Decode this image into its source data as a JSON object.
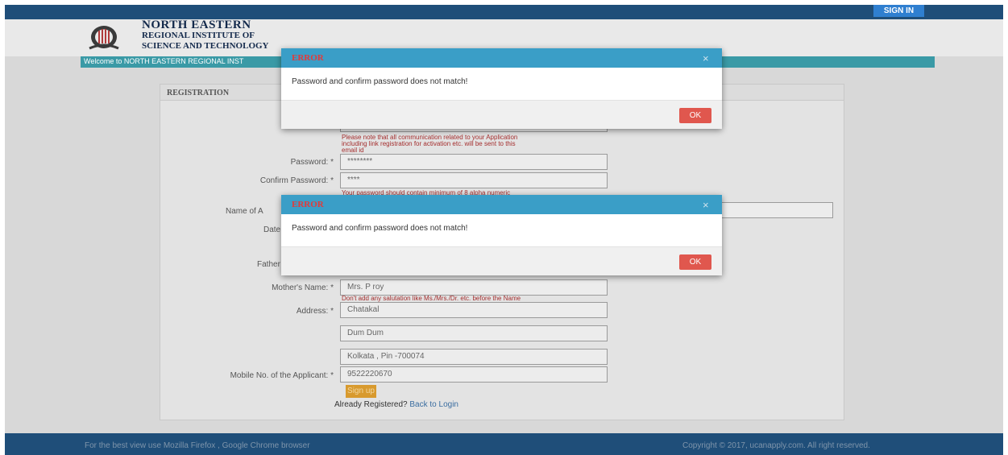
{
  "topbar": {
    "signin_label": "SIGN IN"
  },
  "header": {
    "institute_line1": "NORTH EASTERN",
    "institute_line2": "REGIONAL INSTITUTE OF",
    "institute_line3": "SCIENCE AND TECHNOLOGY",
    "welcome_text": "Welcome to NORTH EASTERN REGIONAL INST"
  },
  "registration": {
    "title": "REGISTRATION",
    "email_hint": "Please note that all communication related to your Application including link registration for activation etc. will be sent to this email id",
    "email_hint_lines": [
      "Please note that all communication related to your Application",
      "including link registration for activation etc. will be sent to this",
      "email id"
    ],
    "password_label": "Password: *",
    "password_value": "********",
    "confirm_password_label": "Confirm Password: *",
    "confirm_password_value": "****",
    "password_hint": "Your password should contain minimum of 8 alpha numeric",
    "name_label": "Name of A",
    "date_label": "Date",
    "father_label": "Father",
    "mother_label": "Mother's Name: *",
    "mother_value": "Mrs. P roy",
    "mother_hint": "Don't add any salutation like Ms./Mrs./Dr. etc. before the Name",
    "address_label": "Address: *",
    "address_line1": "Chatakal",
    "address_line2": "Dum Dum",
    "address_line3": "Kolkata , Pin -700074",
    "mobile_label": "Mobile No. of the Applicant: *",
    "mobile_value": "9522220670",
    "signup_label": "Sign up",
    "already_registered": "Already Registered?",
    "back_to_login": "Back to Login"
  },
  "dialogs": [
    {
      "title": "ERROR",
      "message": "Password and confirm password does not match!",
      "close": "×",
      "ok_label": "OK"
    },
    {
      "title": "ERROR",
      "message": "Password and confirm password does not match!",
      "close": "×",
      "ok_label": "OK"
    }
  ],
  "footer": {
    "left_text": "For the best view use Mozilla Firefox , Google Chrome browser",
    "right_text": "Copyright © 2017, ucanapply.com. All right reserved."
  },
  "colors": {
    "topbar": "#1f4e79",
    "accent": "#3a9ec7",
    "error_title": "#e33a3a",
    "ok_button": "#e0574e",
    "signup_button": "#d89a2e"
  }
}
